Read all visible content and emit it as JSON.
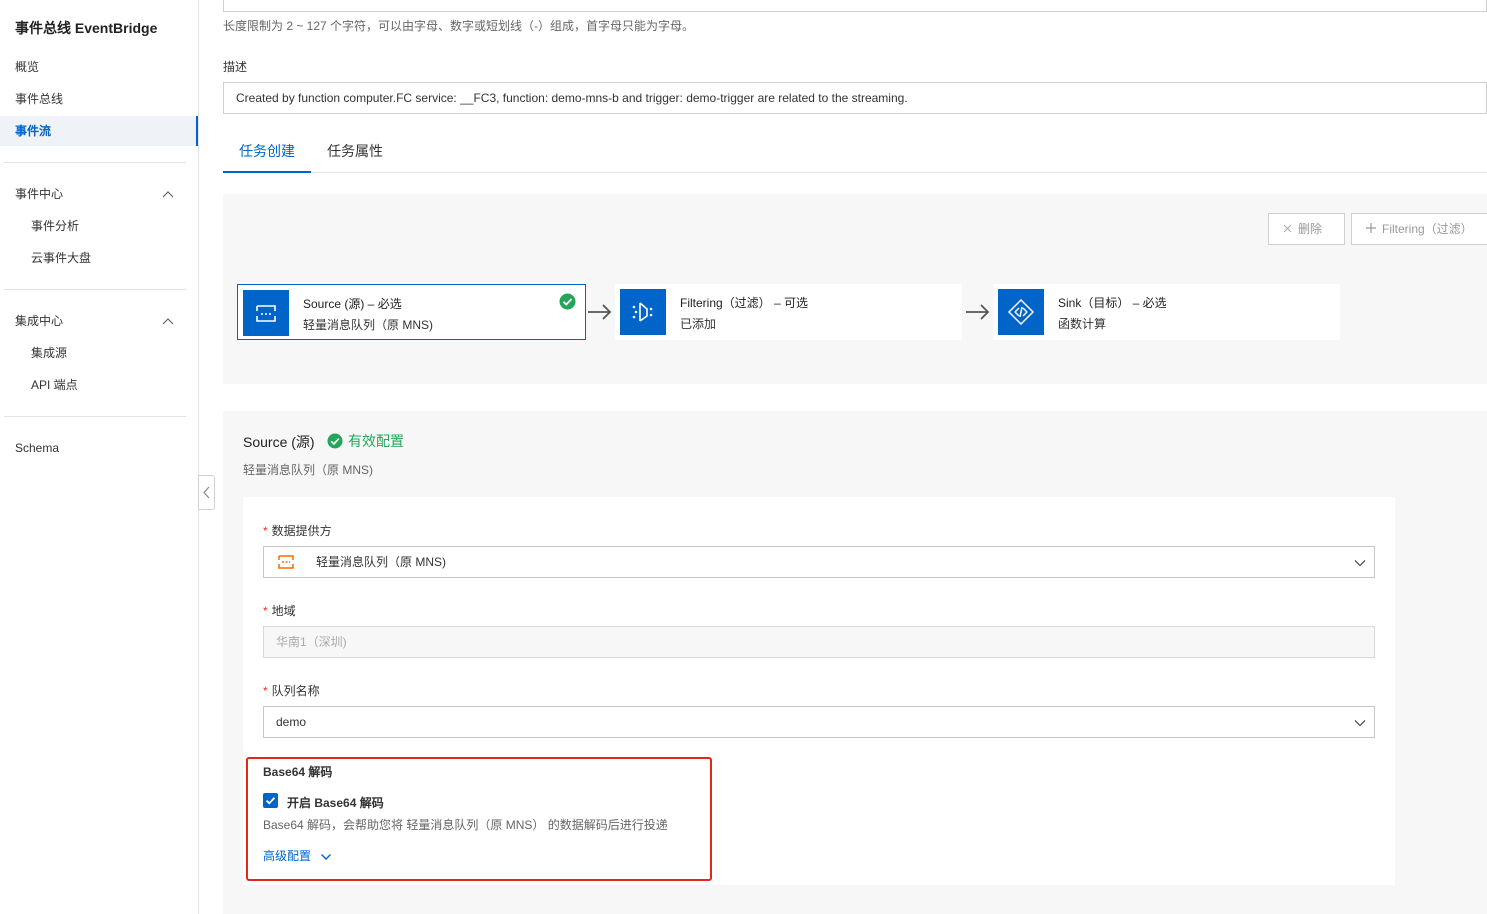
{
  "sidebar": {
    "title": "事件总线 EventBridge",
    "items": [
      {
        "label": "概览"
      },
      {
        "label": "事件总线"
      },
      {
        "label": "事件流"
      },
      {
        "label": "事件中心"
      },
      {
        "label": "事件分析"
      },
      {
        "label": "云事件大盘"
      },
      {
        "label": "集成中心"
      },
      {
        "label": "集成源"
      },
      {
        "label": "API 端点"
      },
      {
        "label": "Schema"
      }
    ],
    "active_item": "事件流"
  },
  "form": {
    "name_hint": "长度限制为 2 ~ 127 个字符，可以由字母、数字或短划线（-）组成，首字母只能为字母。",
    "description_label": "描述",
    "description_value": "Created by function computer.FC service: __FC3, function: demo-mns-b and trigger: demo-trigger are related to the streaming."
  },
  "tabs": [
    {
      "label": "任务创建",
      "active": true
    },
    {
      "label": "任务属性",
      "active": false
    }
  ],
  "flow": {
    "delete_label": "删除",
    "add_filtering_label": "Filtering（过滤）",
    "steps": [
      {
        "title": "Source (源) – 必选",
        "subtitle": "轻量消息队列（原 MNS)",
        "icon": "source-queue-icon"
      },
      {
        "title": "Filtering（过滤） – 可选",
        "subtitle": "已添加",
        "icon": "filter-icon"
      },
      {
        "title": "Sink（目标） – 必选",
        "subtitle": "函数计算",
        "icon": "function-compute-icon"
      }
    ]
  },
  "source": {
    "title": "Source (源)",
    "status": "有效配置",
    "subtitle": "轻量消息队列（原 MNS)",
    "provider_label": "数据提供方",
    "provider_value": "轻量消息队列（原 MNS)",
    "region_label": "地域",
    "region_value": "华南1（深圳)",
    "queue_label": "队列名称",
    "queue_value": "demo",
    "base64_label": "Base64 解码",
    "base64_checkbox_label": "开启 Base64 解码",
    "base64_checked": true,
    "base64_help": "Base64 解码，会帮助您将 轻量消息队列（原 MNS） 的数据解码后进行投递",
    "advanced_label": "高级配置"
  },
  "colors": {
    "primary": "#0064c8",
    "success": "#25a55a",
    "highlight": "#e0291a",
    "provider_icon": "#ff6a00"
  }
}
